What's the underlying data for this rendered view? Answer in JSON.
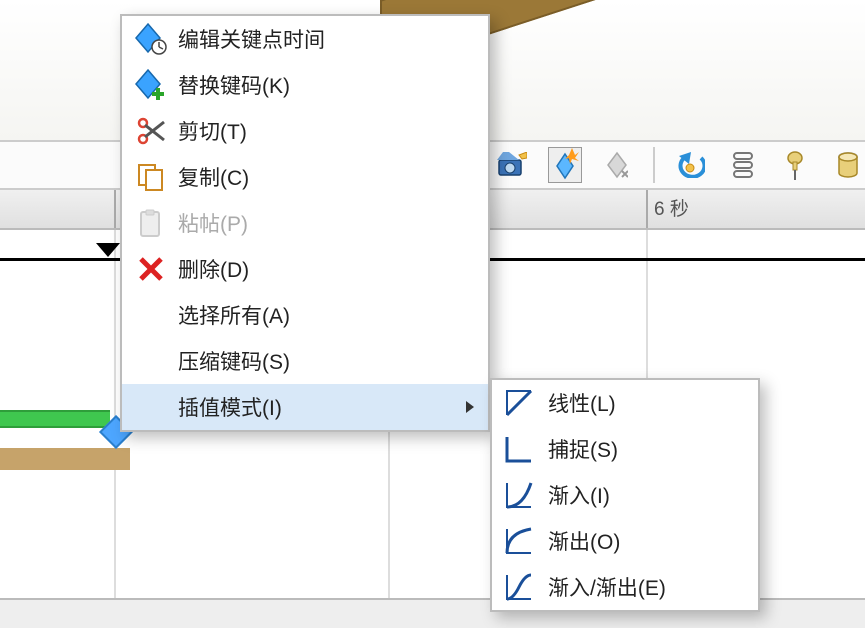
{
  "ruler": {
    "tick_6s": "6 秒"
  },
  "context_menu": {
    "edit_keyframe_time": "编辑关键点时间",
    "replace_keycode": "替换键码(K)",
    "cut": "剪切(T)",
    "copy": "复制(C)",
    "paste": "粘帖(P)",
    "delete": "删除(D)",
    "select_all": "选择所有(A)",
    "compress_keycode": "压缩键码(S)",
    "interpolation_mode": "插值模式(I)"
  },
  "submenu": {
    "linear": "线性(L)",
    "snap": "捕捉(S)",
    "ease_in": "渐入(I)",
    "ease_out": "渐出(O)",
    "ease_in_out": "渐入/渐出(E)"
  },
  "toolbar_icons": {
    "camera": "camera-icon",
    "keyframe_spark": "keyframe-spark-icon",
    "keyframe_grey": "keyframe-grey-icon",
    "return": "return-arrow-icon",
    "stack": "stack-icon",
    "pin": "pin-icon",
    "cylinder": "cylinder-icon"
  }
}
